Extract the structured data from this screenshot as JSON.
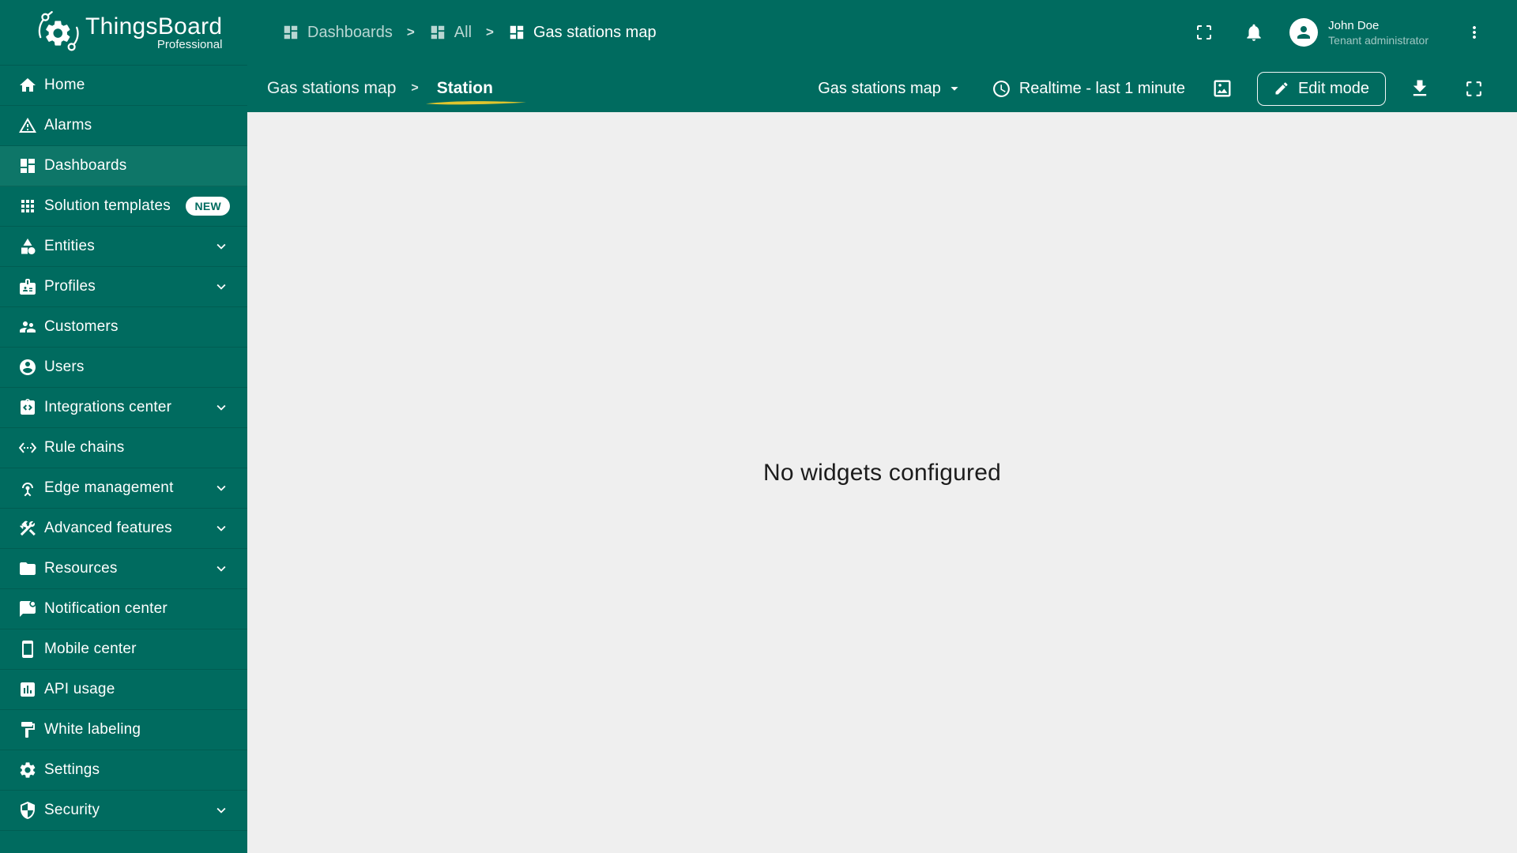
{
  "header": {
    "logo": {
      "title": "ThingsBoard",
      "subtitle": "Professional"
    },
    "separator": ">",
    "breadcrumbs": [
      {
        "label": "Dashboards"
      },
      {
        "label": "All"
      },
      {
        "label": "Gas stations map"
      }
    ],
    "user": {
      "name": "John Doe",
      "role": "Tenant administrator"
    }
  },
  "sidebar": {
    "items": [
      {
        "label": "Home",
        "icon": "home-icon"
      },
      {
        "label": "Alarms",
        "icon": "alarm-warning-icon"
      },
      {
        "label": "Dashboards",
        "icon": "dashboards-icon",
        "selected": true
      },
      {
        "label": "Solution templates",
        "icon": "apps-grid-icon",
        "badge": "NEW"
      },
      {
        "label": "Entities",
        "icon": "entities-category-icon",
        "expandable": true
      },
      {
        "label": "Profiles",
        "icon": "badge-icon",
        "expandable": true
      },
      {
        "label": "Customers",
        "icon": "customers-people-icon"
      },
      {
        "label": "Users",
        "icon": "user-circle-icon"
      },
      {
        "label": "Integrations center",
        "icon": "integration-icon",
        "expandable": true
      },
      {
        "label": "Rule chains",
        "icon": "rule-chain-icon"
      },
      {
        "label": "Edge management",
        "icon": "antenna-icon",
        "expandable": true
      },
      {
        "label": "Advanced features",
        "icon": "tools-icon",
        "expandable": true
      },
      {
        "label": "Resources",
        "icon": "folder-icon",
        "expandable": true
      },
      {
        "label": "Notification center",
        "icon": "notification-flag-icon"
      },
      {
        "label": "Mobile center",
        "icon": "smartphone-icon"
      },
      {
        "label": "API usage",
        "icon": "bar-chart-icon"
      },
      {
        "label": "White labeling",
        "icon": "paint-roller-icon"
      },
      {
        "label": "Settings",
        "icon": "gear-icon"
      },
      {
        "label": "Security",
        "icon": "shield-icon",
        "expandable": true
      }
    ]
  },
  "toolbar": {
    "separator": ">",
    "dashboard_title": "Gas stations map",
    "state_title": "Station",
    "dashboard_select": "Gas stations map",
    "time_window": "Realtime - last 1 minute",
    "edit_button": "Edit mode"
  },
  "main": {
    "empty_message": "No widgets configured"
  },
  "colors": {
    "primary_bg": "#006B5F",
    "selected_item_bg": "#0E7668",
    "content_bg": "#EFEFEF",
    "accent_underline": "#DFC52E"
  }
}
